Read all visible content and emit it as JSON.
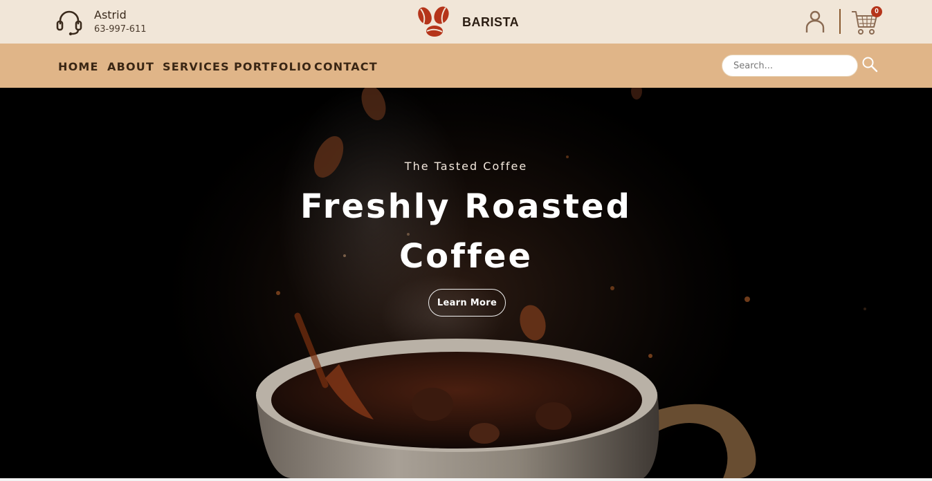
{
  "topbar": {
    "contact": {
      "name": "Astrid",
      "phone": "63-997-611",
      "icon": "headset-icon"
    },
    "brand": {
      "name": "BARISTA",
      "logo": "coffee-beans-logo"
    },
    "actions": {
      "user_icon": "user-icon",
      "cart_icon": "cart-icon",
      "cart_count": "0"
    }
  },
  "nav": {
    "items": [
      {
        "label": "HOME"
      },
      {
        "label": "ABOUT"
      },
      {
        "label": "SERVICES"
      },
      {
        "label": "PORTFOLIO"
      },
      {
        "label": "CONTACT"
      }
    ],
    "search": {
      "placeholder": "Search...",
      "icon": "search-icon"
    }
  },
  "hero": {
    "subtitle": "The Tasted Coffee",
    "title_line1": "Freshly Roasted",
    "title_line2": "Coffee",
    "button": "Learn More"
  },
  "colors": {
    "topbar_bg": "#f1e6d8",
    "navbar_bg": "#e0b588",
    "accent_red": "#b5341a",
    "nav_text": "#3a2614"
  }
}
